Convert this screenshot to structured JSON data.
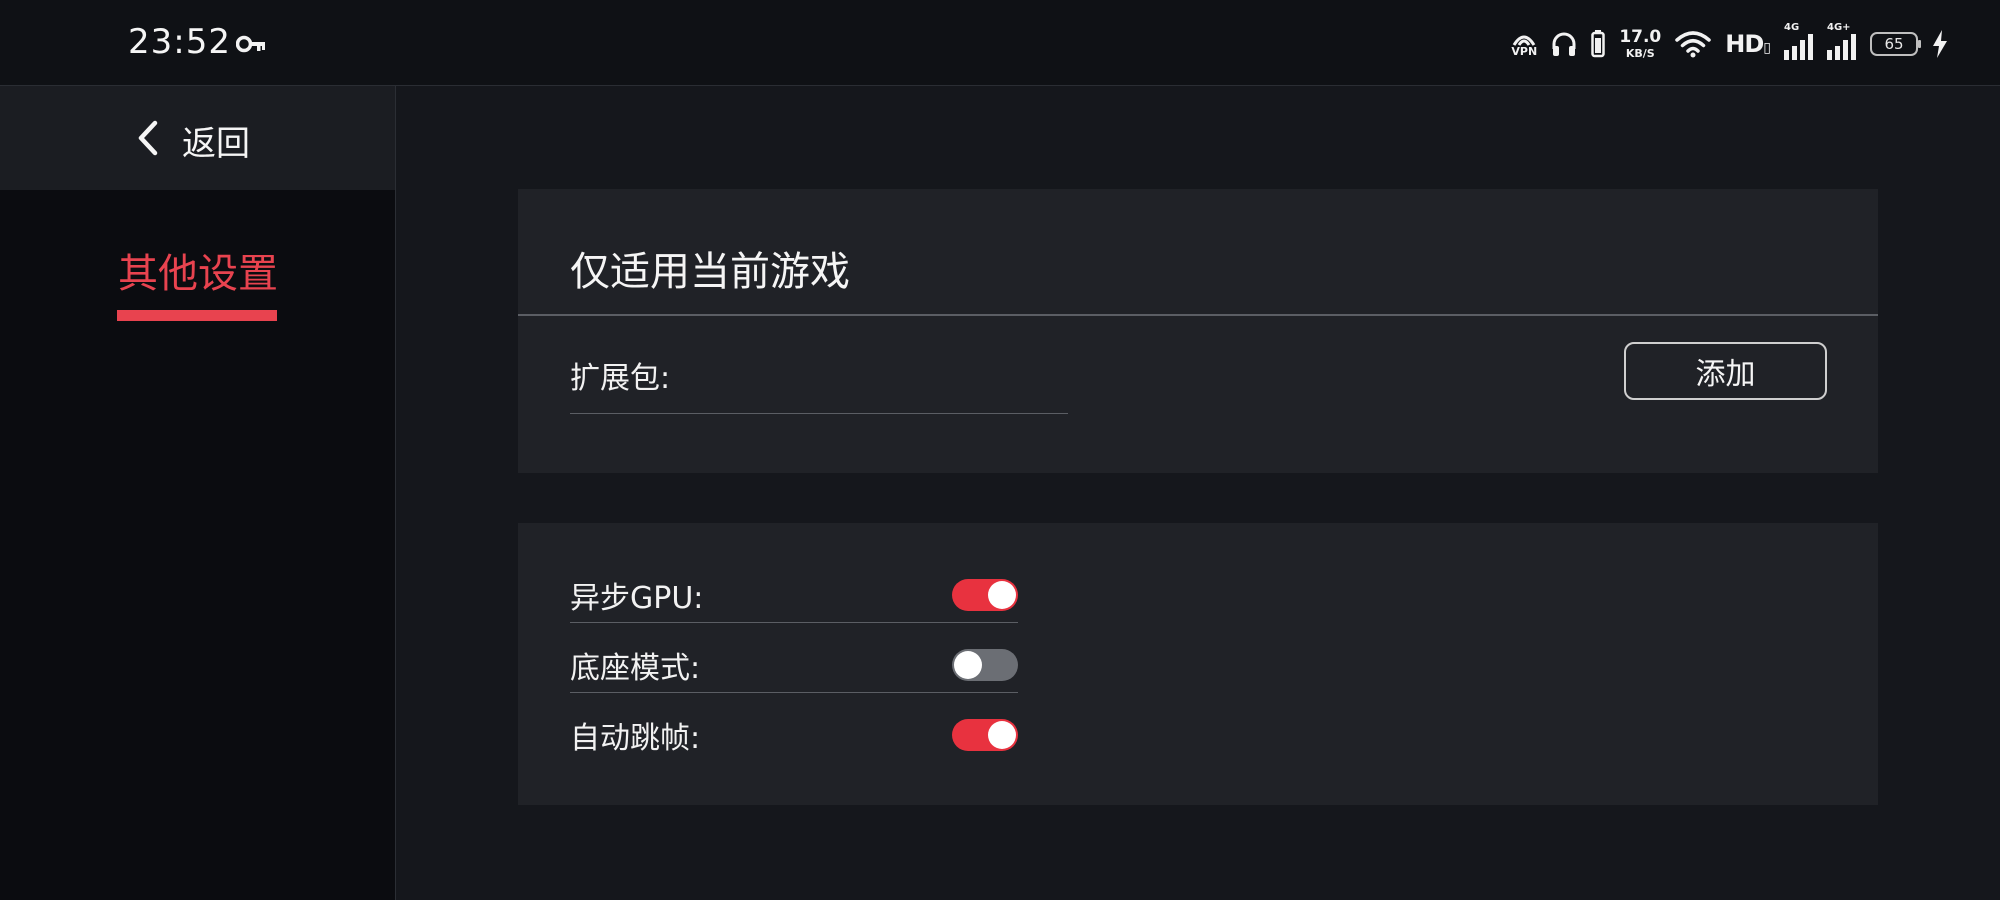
{
  "status_bar": {
    "time": "23:52",
    "key_icon": "key-icon",
    "vpn_label": "VPN",
    "net_speed_value": "17.0",
    "net_speed_unit": "KB/S",
    "hd_label": "HD",
    "signal_1_label": "4G",
    "signal_2_label": "4G+",
    "battery_level": "65"
  },
  "sidebar": {
    "back_label": "返回",
    "items": [
      {
        "label": "其他设置",
        "active": true
      }
    ],
    "accent_color": "#e8434f"
  },
  "main": {
    "card1": {
      "title": "仅适用当前游戏",
      "expansion_label": "扩展包:",
      "add_button": "添加"
    },
    "card2": {
      "settings": [
        {
          "label": "异步GPU:",
          "enabled": true
        },
        {
          "label": "底座模式:",
          "enabled": false
        },
        {
          "label": "自动跳帧:",
          "enabled": true
        }
      ]
    },
    "toggle_on_color": "#e8323f",
    "toggle_off_color": "#6b6e74"
  }
}
